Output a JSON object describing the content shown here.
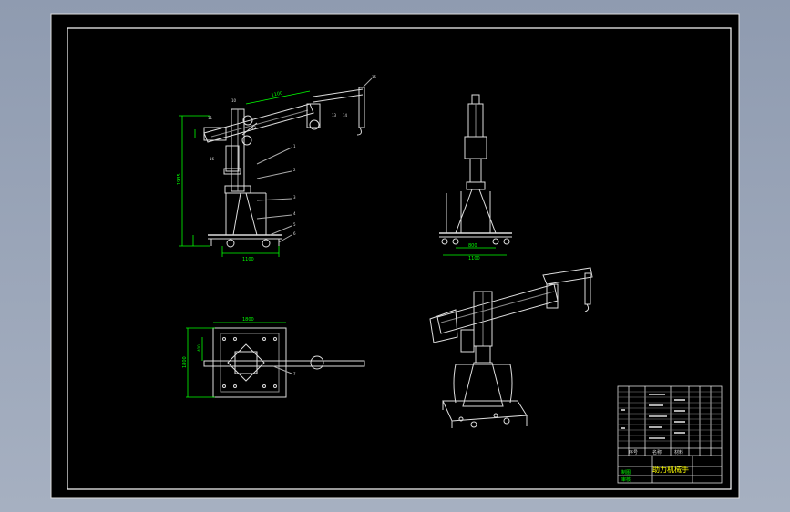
{
  "drawing": {
    "title_block": {
      "title_text": "助力机械手",
      "header_labels": [
        "序号",
        "名称",
        "材料"
      ],
      "bottom_labels": [
        "制图",
        "审核"
      ]
    },
    "dimensions": {
      "top_length": "1100",
      "height_total": "1935",
      "base_width_front": "1100",
      "base_width_side_inner": "800",
      "base_width_side_outer": "1100",
      "top_view_width": "1800",
      "top_view_depth": "1800",
      "small_left": "400",
      "small_step": "200"
    },
    "part_numbers": [
      "10",
      "11",
      "12",
      "13",
      "14",
      "15",
      "16",
      "1",
      "2",
      "3",
      "4",
      "5",
      "6",
      "7",
      "8",
      "9"
    ],
    "colors": {
      "sheet": "#000000",
      "frame": "#ffffff",
      "dimension": "#00ff00",
      "outer_bg": "#9aa6b8"
    }
  }
}
